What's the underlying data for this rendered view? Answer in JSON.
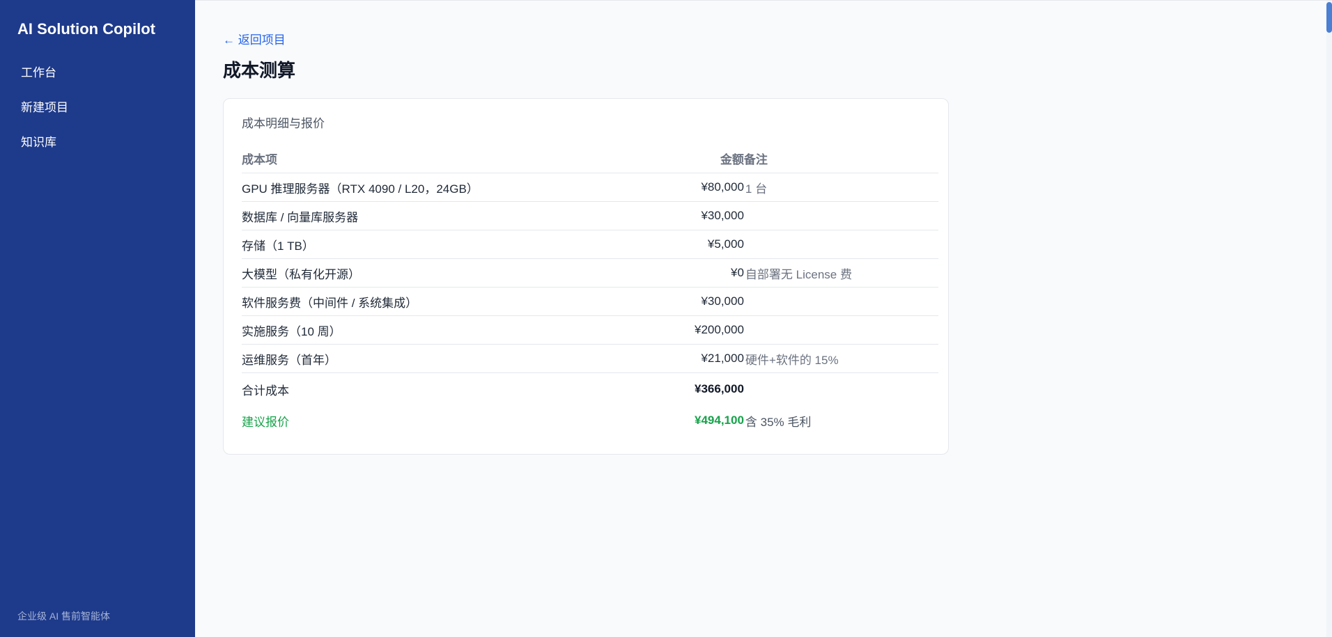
{
  "sidebar": {
    "brand": "AI Solution Copilot",
    "items": [
      {
        "label": "工作台"
      },
      {
        "label": "新建项目"
      },
      {
        "label": "知识库"
      }
    ],
    "footer": "企业级 AI 售前智能体"
  },
  "main": {
    "back_label": "← 返回项目",
    "title": "成本测算",
    "card": {
      "title": "成本明细与报价",
      "headers": {
        "item": "成本项",
        "amount": "金额",
        "note": "备注"
      },
      "rows": [
        {
          "item": "GPU 推理服务器（RTX 4090 / L20，24GB）",
          "amount": "¥80,000",
          "note": "1 台"
        },
        {
          "item": "数据库 / 向量库服务器",
          "amount": "¥30,000",
          "note": ""
        },
        {
          "item": "存储（1 TB）",
          "amount": "¥5,000",
          "note": ""
        },
        {
          "item": "大模型（私有化开源）",
          "amount": "¥0",
          "note": "自部署无 License 费"
        },
        {
          "item": "软件服务费（中间件 / 系统集成）",
          "amount": "¥30,000",
          "note": ""
        },
        {
          "item": "实施服务（10 周）",
          "amount": "¥200,000",
          "note": ""
        },
        {
          "item": "运维服务（首年）",
          "amount": "¥21,000",
          "note": "硬件+软件的 15%"
        }
      ],
      "total": {
        "label": "合计成本",
        "amount": "¥366,000"
      },
      "quote": {
        "label": "建议报价",
        "amount": "¥494,100",
        "note": "含 35% 毛利"
      }
    }
  },
  "colors": {
    "sidebar_bg": "#1e3a8a",
    "accent": "#2563eb",
    "quote_green": "#16a34a"
  }
}
